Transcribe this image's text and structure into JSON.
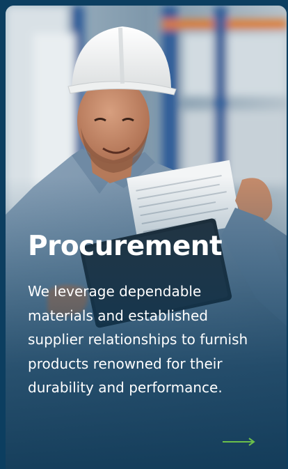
{
  "card": {
    "title": "Procurement",
    "description": "We leverage dependable materials and established supplier relationships to furnish products renowned for their durability and performance.",
    "arrow_icon": "arrow-right-icon",
    "colors": {
      "background": "#0c3e60",
      "text": "#ffffff",
      "arrow": "#6cc04a",
      "helmet": "#f4f4f2",
      "shirt": "#7d97b0"
    }
  }
}
